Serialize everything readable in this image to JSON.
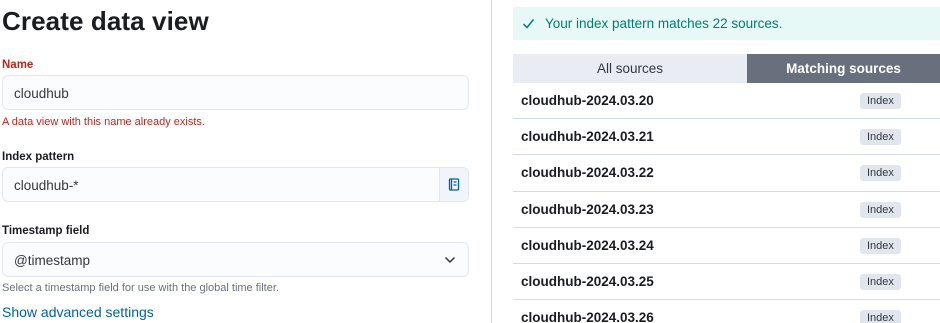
{
  "page": {
    "title": "Create data view"
  },
  "form": {
    "name": {
      "label": "Name",
      "value": "cloudhub",
      "error": "A data view with this name already exists."
    },
    "index_pattern": {
      "label": "Index pattern",
      "value": "cloudhub-*",
      "append_icon": "index-icon"
    },
    "timestamp": {
      "label": "Timestamp field",
      "value": "@timestamp",
      "help": "Select a timestamp field for use with the global time filter."
    },
    "advanced_link": "Show advanced settings"
  },
  "callout": {
    "icon": "check-icon",
    "text": "Your index pattern matches 22 sources."
  },
  "tabs": [
    {
      "label": "All sources",
      "selected": false
    },
    {
      "label": "Matching sources",
      "selected": true
    }
  ],
  "sources": [
    {
      "name": "cloudhub-2024.03.20",
      "type": "Index"
    },
    {
      "name": "cloudhub-2024.03.21",
      "type": "Index"
    },
    {
      "name": "cloudhub-2024.03.22",
      "type": "Index"
    },
    {
      "name": "cloudhub-2024.03.23",
      "type": "Index"
    },
    {
      "name": "cloudhub-2024.03.24",
      "type": "Index"
    },
    {
      "name": "cloudhub-2024.03.25",
      "type": "Index"
    },
    {
      "name": "cloudhub-2024.03.26",
      "type": "Index"
    }
  ],
  "colors": {
    "error": "#bd271e",
    "success": "#017d73",
    "link": "#0061a6",
    "selected_tab": "#69707d"
  }
}
